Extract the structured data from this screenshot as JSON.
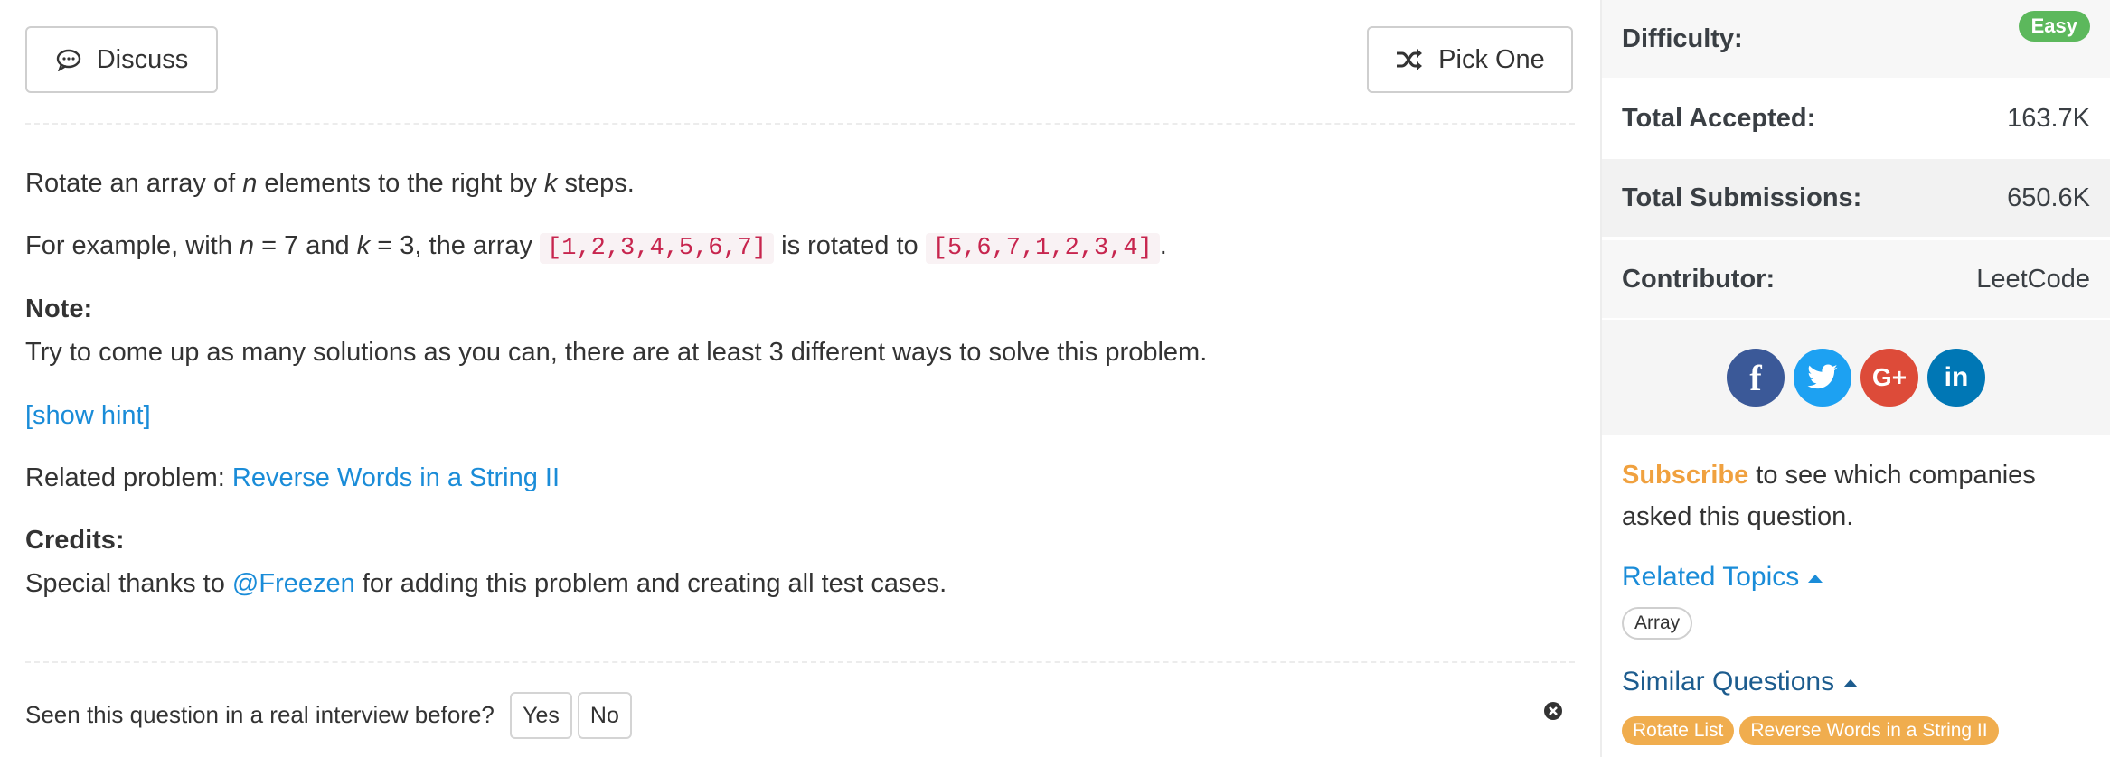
{
  "toolbar": {
    "discuss_label": "Discuss",
    "pick_label": "Pick One"
  },
  "problem": {
    "l1_pre": "Rotate an array of ",
    "l1_n": "n",
    "l1_mid": " elements to the right by ",
    "l1_k": "k",
    "l1_post": " steps.",
    "l2_pre": "For example, with ",
    "l2_n": "n",
    "l2_eq1": " = 7 and ",
    "l2_k": "k",
    "l2_eq2": " = 3, the array ",
    "l2_code1": "[1,2,3,4,5,6,7]",
    "l2_mid": " is rotated to ",
    "l2_code2": "[5,6,7,1,2,3,4]",
    "l2_post": ".",
    "note_heading": "Note:",
    "note_text": "Try to come up as many solutions as you can, there are at least 3 different ways to solve this problem.",
    "hint_link": "[show hint]",
    "related_prefix": "Related problem: ",
    "related_link": "Reverse Words in a String II",
    "credits_heading": "Credits:",
    "credits_pre": "Special thanks to ",
    "credits_link": "@Freezen",
    "credits_post": " for adding this problem and creating all test cases."
  },
  "interview": {
    "question": "Seen this question in a real interview before?",
    "yes": "Yes",
    "no": "No"
  },
  "sidebar": {
    "difficulty_label": "Difficulty:",
    "difficulty_value": "Easy",
    "accepted_label": "Total Accepted:",
    "accepted_value": "163.7K",
    "submissions_label": "Total Submissions:",
    "submissions_value": "650.6K",
    "contributor_label": "Contributor:",
    "contributor_value": "LeetCode",
    "social": {
      "facebook": "f",
      "google": "G+",
      "linkedin": "in"
    },
    "subscribe_link": "Subscribe",
    "subscribe_text": " to see which companies asked this question.",
    "related_topics_label": "Related Topics",
    "topic_tag": "Array",
    "similar_label": "Similar Questions",
    "similar_tags": [
      "Rotate List",
      "Reverse Words in a String II"
    ]
  },
  "colors": {
    "link": "#1a8cd8",
    "easy_badge": "#5cb85c",
    "orange_tag": "#f0ad4e",
    "code": "#c7254e"
  }
}
